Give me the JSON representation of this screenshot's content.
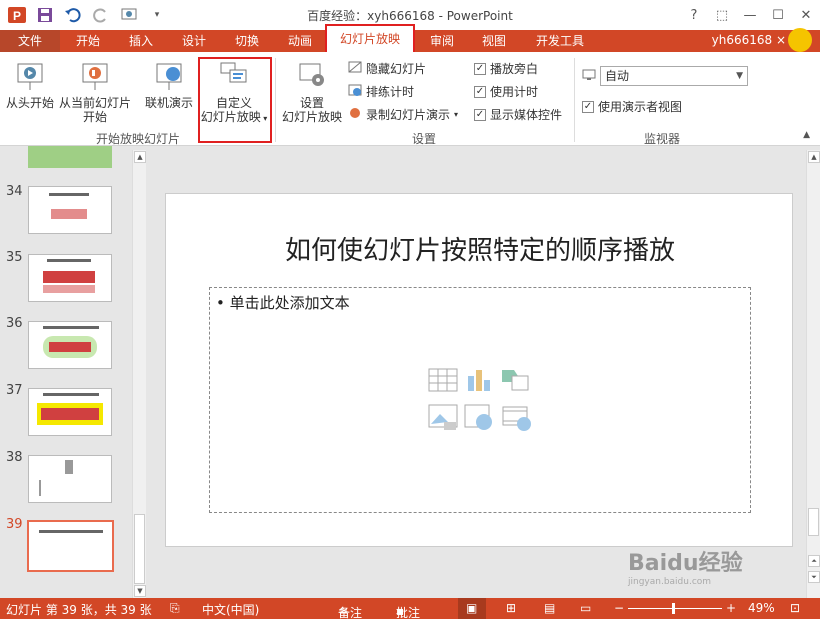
{
  "window": {
    "title": "百度经验：xyh666168 - PowerPoint",
    "help": "?",
    "minimize": "—",
    "maximize": "☐",
    "close": "✕"
  },
  "tabs": [
    {
      "label": "文件"
    },
    {
      "label": "开始"
    },
    {
      "label": "插入"
    },
    {
      "label": "设计"
    },
    {
      "label": "切换"
    },
    {
      "label": "动画"
    },
    {
      "label": "幻灯片放映"
    },
    {
      "label": "审阅"
    },
    {
      "label": "视图"
    },
    {
      "label": "开发工具"
    }
  ],
  "user": "yh666168 ×",
  "ribbon": {
    "from_beginning": "从头开始",
    "from_current_1": "从当前幻灯片",
    "from_current_2": "开始",
    "online": "联机演示",
    "custom_1": "自定义",
    "custom_2": "幻灯片放映",
    "group_start": "开始放映幻灯片",
    "setup_1": "设置",
    "setup_2": "幻灯片放映",
    "hide_slide": "隐藏幻灯片",
    "rehearse": "排练计时",
    "record": "录制幻灯片演示",
    "play_narrations": "播放旁白",
    "use_timings": "使用计时",
    "show_media": "显示媒体控件",
    "group_setup": "设置",
    "monitor_value": "自动",
    "presenter_view": "使用演示者视图",
    "group_monitors": "监视器"
  },
  "thumbnails": [
    {
      "num": "34"
    },
    {
      "num": "35"
    },
    {
      "num": "36"
    },
    {
      "num": "37"
    },
    {
      "num": "38"
    },
    {
      "num": "39"
    }
  ],
  "slide": {
    "title": "如何使幻灯片按照特定的顺序播放",
    "body_placeholder": "• 单击此处添加文本"
  },
  "status": {
    "slide_info": "幻灯片 第 39 张，共 39 张",
    "language": "中文(中国)",
    "notes": "备注",
    "comments": "批注",
    "zoom": "49%"
  },
  "watermark": "Baidu经验",
  "watermark_sub": "jingyan.baidu.com",
  "colors": {
    "accent": "#d24726",
    "highlight": "#e02020"
  }
}
